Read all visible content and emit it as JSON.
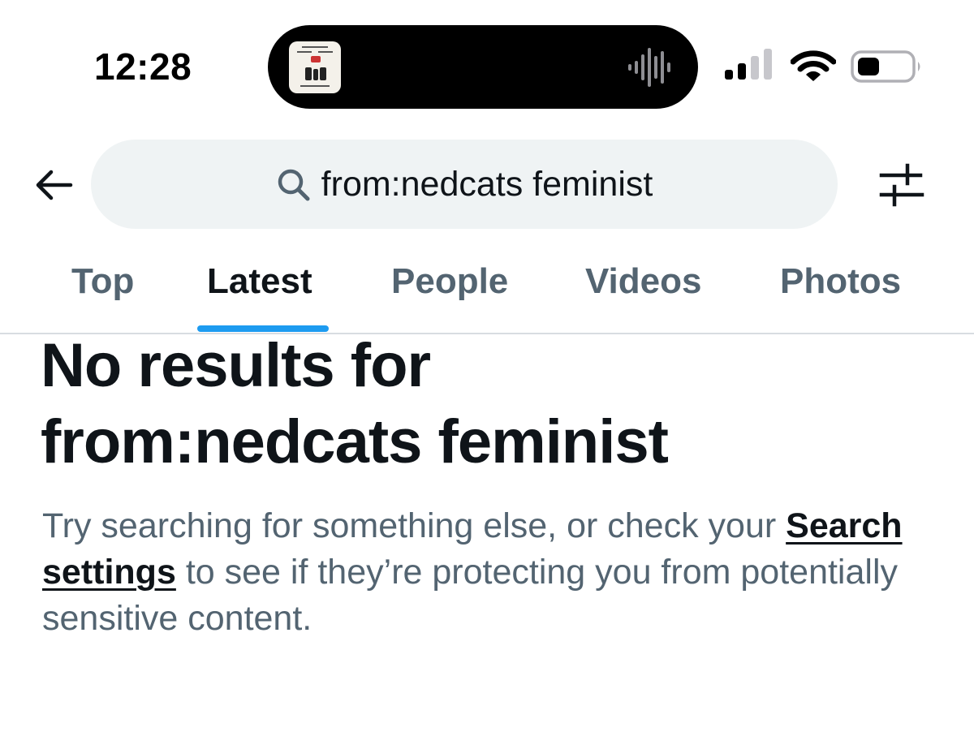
{
  "status_bar": {
    "time": "12:28",
    "icons": [
      "now-playing-artwork-icon",
      "audio-waveform-icon",
      "cellular-signal-icon",
      "wifi-icon",
      "battery-icon"
    ]
  },
  "header": {
    "back_icon": "arrow-left-icon",
    "search_icon": "search-icon",
    "search_query": "from:nedcats feminist",
    "filter_icon": "sliders-icon"
  },
  "tabs": [
    {
      "label": "Top",
      "active": false
    },
    {
      "label": "Latest",
      "active": true
    },
    {
      "label": "People",
      "active": false
    },
    {
      "label": "Videos",
      "active": false
    },
    {
      "label": "Photos",
      "active": false
    }
  ],
  "empty_state": {
    "title_line1": "No results for",
    "title_line2": "from:nedcats feminist",
    "desc_before_link": "Try searching for something else, or check your",
    "link_text": "Search settings",
    "desc_after_link": "to see if they’re protecting you from potentially sensitive content."
  },
  "colors": {
    "accent": "#1d9bf0",
    "text_primary": "#0f1419",
    "text_secondary": "#536471",
    "search_bg": "#eff3f4",
    "divider": "#d8dde1"
  }
}
